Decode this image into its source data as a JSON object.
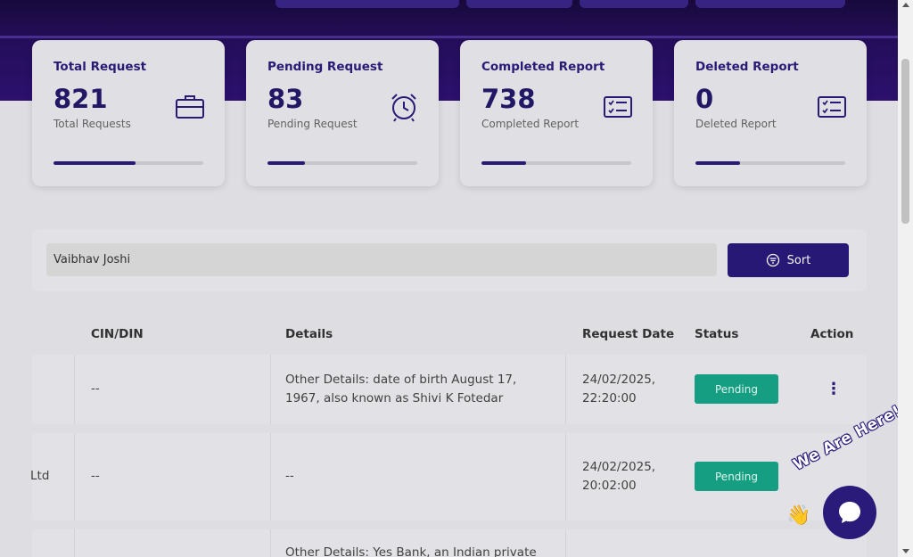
{
  "stats": [
    {
      "title": "Total Request",
      "value": "821",
      "sub": "Total Requests",
      "icon": "briefcase-icon",
      "progress": 0.55
    },
    {
      "title": "Pending Request",
      "value": "83",
      "sub": "Pending Request",
      "icon": "alarm-clock-icon",
      "progress": 0.25
    },
    {
      "title": "Completed Report",
      "value": "738",
      "sub": "Completed Report",
      "icon": "checklist-icon",
      "progress": 0.3
    },
    {
      "title": "Deleted Report",
      "value": "0",
      "sub": "Deleted Report",
      "icon": "checklist-icon",
      "progress": 0.3
    }
  ],
  "search": {
    "value": "Vaibhav Joshi"
  },
  "sort_label": "Sort",
  "table": {
    "headers": {
      "cin": "CIN/DIN",
      "details": "Details",
      "date": "Request Date",
      "status": "Status",
      "action": "Action"
    },
    "rows": [
      {
        "name": "",
        "cin": "--",
        "details": "Other Details: date of birth August 17, 1967, also known as Shivi K Fotedar",
        "date": "24/02/2025, 22:20:00",
        "status": "Pending"
      },
      {
        "name": "Ltd",
        "cin": "--",
        "details": "--",
        "date": "24/02/2025, 20:02:00",
        "status": "Pending"
      },
      {
        "name": "",
        "cin": "",
        "details": "Other Details: Yes Bank, an Indian private",
        "date": "",
        "status": ""
      }
    ]
  },
  "chat": {
    "tagline": "We Are Here!"
  },
  "colors": {
    "brand": "#2a1a7a",
    "pending": "#17a589"
  }
}
